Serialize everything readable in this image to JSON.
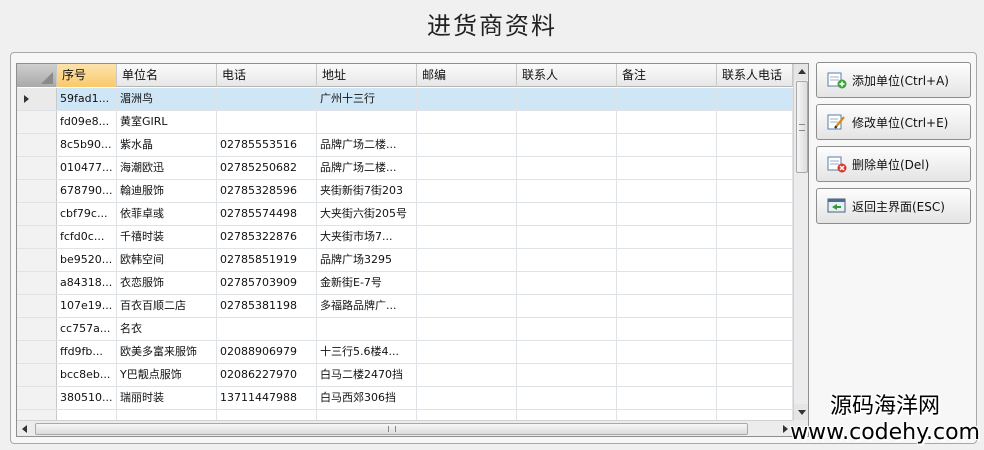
{
  "window": {
    "title": "进货商资料"
  },
  "grid": {
    "columns": [
      "序号",
      "单位名",
      "电话",
      "地址",
      "邮编",
      "联系人",
      "备注",
      "联系人电话"
    ],
    "rows": [
      [
        "59fad1...",
        "湄洲鸟",
        "",
        "广州十三行",
        "",
        "",
        "",
        ""
      ],
      [
        "fd09e8...",
        "黄室GIRL",
        "",
        "",
        "",
        "",
        "",
        ""
      ],
      [
        "8c5b90...",
        "紫水晶",
        "02785553516",
        "品牌广场二楼...",
        "",
        "",
        "",
        ""
      ],
      [
        "010477...",
        "海潮欧迅",
        "02785250682",
        "品牌广场二楼...",
        "",
        "",
        "",
        ""
      ],
      [
        "678790...",
        "翰迪服饰",
        "02785328596",
        "夹街新街7街203",
        "",
        "",
        "",
        ""
      ],
      [
        "cbf79c...",
        "依菲卓彧",
        "02785574498",
        "大夹街六街205号",
        "",
        "",
        "",
        ""
      ],
      [
        "fcfd0c...",
        "千禧时装",
        "02785322876",
        "大夹街市场7...",
        "",
        "",
        "",
        ""
      ],
      [
        "be9520...",
        "欧韩空间",
        "02785851919",
        "品牌广场3295",
        "",
        "",
        "",
        ""
      ],
      [
        "a84318...",
        "衣恋服饰",
        "02785703909",
        "金新街E-7号",
        "",
        "",
        "",
        ""
      ],
      [
        "107e19...",
        "百衣百顺二店",
        "02785381198",
        "多福路品牌广...",
        "",
        "",
        "",
        ""
      ],
      [
        "cc757a...",
        "名衣",
        "",
        "",
        "",
        "",
        "",
        ""
      ],
      [
        "ffd9fb...",
        "欧美多富来服饰",
        "02088906979",
        "十三行5.6楼4...",
        "",
        "",
        "",
        ""
      ],
      [
        "bcc8eb...",
        "Y巴靓点服饰",
        "02086227970",
        "白马二楼2470挡",
        "",
        "",
        "",
        ""
      ],
      [
        "380510...",
        "瑞丽时装",
        "13711447988",
        "白马西郊306挡",
        "",
        "",
        "",
        ""
      ],
      [
        "",
        "",
        "",
        "",
        "",
        "",
        "",
        ""
      ]
    ]
  },
  "buttons": {
    "add": "添加单位(Ctrl+A)",
    "edit": "修改单位(Ctrl+E)",
    "delete": "删除单位(Del)",
    "back": "返回主界面(ESC)"
  },
  "watermark": {
    "line1": "源码海洋网",
    "line2": "www.codehy.com"
  },
  "colors": {
    "selected_row": "#cfe6f7",
    "active_header": "#f9c96b"
  }
}
